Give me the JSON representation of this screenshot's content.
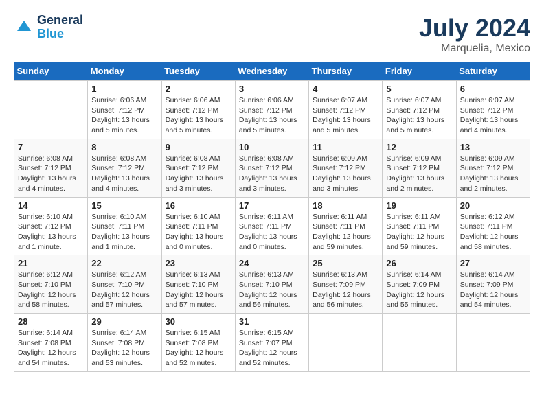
{
  "logo": {
    "line1": "General",
    "line2": "Blue"
  },
  "title": "July 2024",
  "subtitle": "Marquelia, Mexico",
  "header_color": "#1a6bbf",
  "days_of_week": [
    "Sunday",
    "Monday",
    "Tuesday",
    "Wednesday",
    "Thursday",
    "Friday",
    "Saturday"
  ],
  "weeks": [
    [
      {
        "day": "",
        "sunrise": "",
        "sunset": "",
        "daylight": ""
      },
      {
        "day": "1",
        "sunrise": "Sunrise: 6:06 AM",
        "sunset": "Sunset: 7:12 PM",
        "daylight": "Daylight: 13 hours and 5 minutes."
      },
      {
        "day": "2",
        "sunrise": "Sunrise: 6:06 AM",
        "sunset": "Sunset: 7:12 PM",
        "daylight": "Daylight: 13 hours and 5 minutes."
      },
      {
        "day": "3",
        "sunrise": "Sunrise: 6:06 AM",
        "sunset": "Sunset: 7:12 PM",
        "daylight": "Daylight: 13 hours and 5 minutes."
      },
      {
        "day": "4",
        "sunrise": "Sunrise: 6:07 AM",
        "sunset": "Sunset: 7:12 PM",
        "daylight": "Daylight: 13 hours and 5 minutes."
      },
      {
        "day": "5",
        "sunrise": "Sunrise: 6:07 AM",
        "sunset": "Sunset: 7:12 PM",
        "daylight": "Daylight: 13 hours and 5 minutes."
      },
      {
        "day": "6",
        "sunrise": "Sunrise: 6:07 AM",
        "sunset": "Sunset: 7:12 PM",
        "daylight": "Daylight: 13 hours and 4 minutes."
      }
    ],
    [
      {
        "day": "7",
        "sunrise": "Sunrise: 6:08 AM",
        "sunset": "Sunset: 7:12 PM",
        "daylight": "Daylight: 13 hours and 4 minutes."
      },
      {
        "day": "8",
        "sunrise": "Sunrise: 6:08 AM",
        "sunset": "Sunset: 7:12 PM",
        "daylight": "Daylight: 13 hours and 4 minutes."
      },
      {
        "day": "9",
        "sunrise": "Sunrise: 6:08 AM",
        "sunset": "Sunset: 7:12 PM",
        "daylight": "Daylight: 13 hours and 3 minutes."
      },
      {
        "day": "10",
        "sunrise": "Sunrise: 6:08 AM",
        "sunset": "Sunset: 7:12 PM",
        "daylight": "Daylight: 13 hours and 3 minutes."
      },
      {
        "day": "11",
        "sunrise": "Sunrise: 6:09 AM",
        "sunset": "Sunset: 7:12 PM",
        "daylight": "Daylight: 13 hours and 3 minutes."
      },
      {
        "day": "12",
        "sunrise": "Sunrise: 6:09 AM",
        "sunset": "Sunset: 7:12 PM",
        "daylight": "Daylight: 13 hours and 2 minutes."
      },
      {
        "day": "13",
        "sunrise": "Sunrise: 6:09 AM",
        "sunset": "Sunset: 7:12 PM",
        "daylight": "Daylight: 13 hours and 2 minutes."
      }
    ],
    [
      {
        "day": "14",
        "sunrise": "Sunrise: 6:10 AM",
        "sunset": "Sunset: 7:12 PM",
        "daylight": "Daylight: 13 hours and 1 minute."
      },
      {
        "day": "15",
        "sunrise": "Sunrise: 6:10 AM",
        "sunset": "Sunset: 7:11 PM",
        "daylight": "Daylight: 13 hours and 1 minute."
      },
      {
        "day": "16",
        "sunrise": "Sunrise: 6:10 AM",
        "sunset": "Sunset: 7:11 PM",
        "daylight": "Daylight: 13 hours and 0 minutes."
      },
      {
        "day": "17",
        "sunrise": "Sunrise: 6:11 AM",
        "sunset": "Sunset: 7:11 PM",
        "daylight": "Daylight: 13 hours and 0 minutes."
      },
      {
        "day": "18",
        "sunrise": "Sunrise: 6:11 AM",
        "sunset": "Sunset: 7:11 PM",
        "daylight": "Daylight: 12 hours and 59 minutes."
      },
      {
        "day": "19",
        "sunrise": "Sunrise: 6:11 AM",
        "sunset": "Sunset: 7:11 PM",
        "daylight": "Daylight: 12 hours and 59 minutes."
      },
      {
        "day": "20",
        "sunrise": "Sunrise: 6:12 AM",
        "sunset": "Sunset: 7:11 PM",
        "daylight": "Daylight: 12 hours and 58 minutes."
      }
    ],
    [
      {
        "day": "21",
        "sunrise": "Sunrise: 6:12 AM",
        "sunset": "Sunset: 7:10 PM",
        "daylight": "Daylight: 12 hours and 58 minutes."
      },
      {
        "day": "22",
        "sunrise": "Sunrise: 6:12 AM",
        "sunset": "Sunset: 7:10 PM",
        "daylight": "Daylight: 12 hours and 57 minutes."
      },
      {
        "day": "23",
        "sunrise": "Sunrise: 6:13 AM",
        "sunset": "Sunset: 7:10 PM",
        "daylight": "Daylight: 12 hours and 57 minutes."
      },
      {
        "day": "24",
        "sunrise": "Sunrise: 6:13 AM",
        "sunset": "Sunset: 7:10 PM",
        "daylight": "Daylight: 12 hours and 56 minutes."
      },
      {
        "day": "25",
        "sunrise": "Sunrise: 6:13 AM",
        "sunset": "Sunset: 7:09 PM",
        "daylight": "Daylight: 12 hours and 56 minutes."
      },
      {
        "day": "26",
        "sunrise": "Sunrise: 6:14 AM",
        "sunset": "Sunset: 7:09 PM",
        "daylight": "Daylight: 12 hours and 55 minutes."
      },
      {
        "day": "27",
        "sunrise": "Sunrise: 6:14 AM",
        "sunset": "Sunset: 7:09 PM",
        "daylight": "Daylight: 12 hours and 54 minutes."
      }
    ],
    [
      {
        "day": "28",
        "sunrise": "Sunrise: 6:14 AM",
        "sunset": "Sunset: 7:08 PM",
        "daylight": "Daylight: 12 hours and 54 minutes."
      },
      {
        "day": "29",
        "sunrise": "Sunrise: 6:14 AM",
        "sunset": "Sunset: 7:08 PM",
        "daylight": "Daylight: 12 hours and 53 minutes."
      },
      {
        "day": "30",
        "sunrise": "Sunrise: 6:15 AM",
        "sunset": "Sunset: 7:08 PM",
        "daylight": "Daylight: 12 hours and 52 minutes."
      },
      {
        "day": "31",
        "sunrise": "Sunrise: 6:15 AM",
        "sunset": "Sunset: 7:07 PM",
        "daylight": "Daylight: 12 hours and 52 minutes."
      },
      {
        "day": "",
        "sunrise": "",
        "sunset": "",
        "daylight": ""
      },
      {
        "day": "",
        "sunrise": "",
        "sunset": "",
        "daylight": ""
      },
      {
        "day": "",
        "sunrise": "",
        "sunset": "",
        "daylight": ""
      }
    ]
  ]
}
